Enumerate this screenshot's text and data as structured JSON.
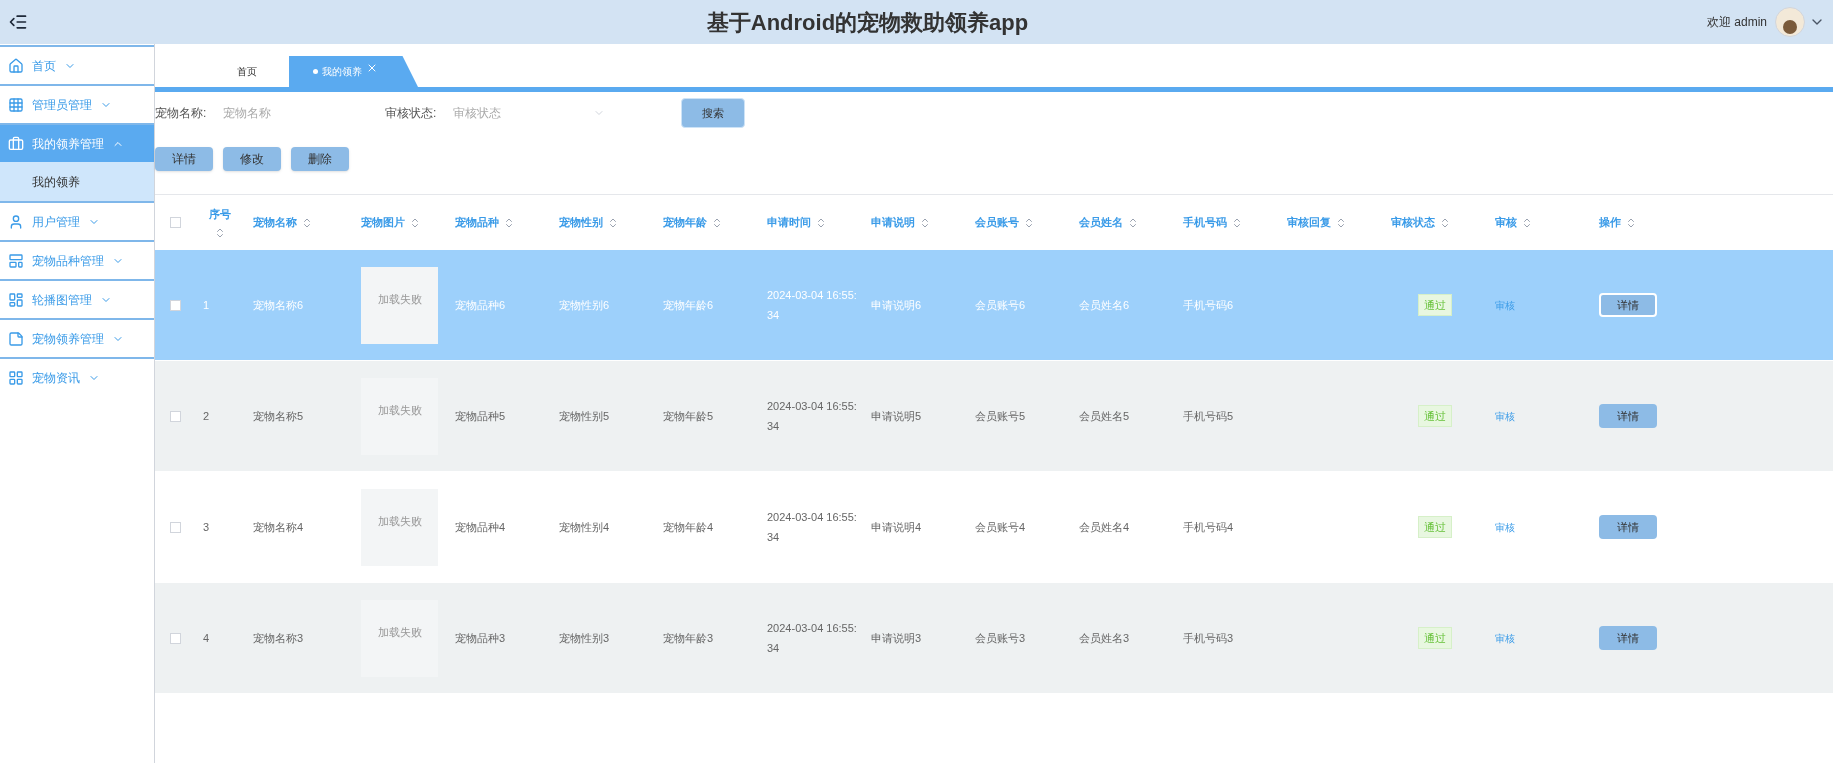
{
  "header": {
    "title": "基于Android的宠物救助领养app",
    "greeting": "欢迎 admin"
  },
  "sidebar": {
    "items": [
      {
        "label": "首页",
        "expanded": false,
        "selected": false
      },
      {
        "label": "管理员管理",
        "expanded": false,
        "selected": false
      },
      {
        "label": "我的领养管理",
        "expanded": true,
        "selected": true,
        "children": [
          {
            "label": "我的领养",
            "selected": true
          }
        ]
      },
      {
        "label": "用户管理",
        "expanded": false,
        "selected": false
      },
      {
        "label": "宠物品种管理",
        "expanded": false,
        "selected": false
      },
      {
        "label": "轮播图管理",
        "expanded": false,
        "selected": false
      },
      {
        "label": "宠物领养管理",
        "expanded": false,
        "selected": false
      },
      {
        "label": "宠物资讯",
        "expanded": false,
        "selected": false
      }
    ]
  },
  "tabs": [
    {
      "label": "首页",
      "selected": false
    },
    {
      "label": "我的领养",
      "selected": true
    }
  ],
  "search": {
    "fields": [
      {
        "label": "宠物名称:",
        "placeholder": "宠物名称",
        "kind": "text"
      },
      {
        "label": "审核状态:",
        "placeholder": "审核状态",
        "kind": "select"
      }
    ],
    "button": "搜索"
  },
  "actions": [
    "详情",
    "修改",
    "删除"
  ],
  "table": {
    "all_checked": false,
    "columns": [
      "序号",
      "宠物名称",
      "宠物图片",
      "宠物品种",
      "宠物性别",
      "宠物年龄",
      "申请时间",
      "申请说明",
      "会员账号",
      "会员姓名",
      "手机号码",
      "审核回复",
      "审核状态",
      "审核",
      "操作"
    ],
    "rows": [
      {
        "selected": true,
        "checked": false,
        "cells": [
          "1",
          "宠物名称6",
          "加载失败",
          "宠物品种6",
          "宠物性别6",
          "宠物年龄6",
          "2024-03-04 16:55:\n34",
          "申请说明6",
          "会员账号6",
          "会员姓名6",
          "手机号码6",
          "",
          "通过",
          "审核",
          "详情"
        ]
      },
      {
        "selected": false,
        "checked": false,
        "cells": [
          "2",
          "宠物名称5",
          "加载失败",
          "宠物品种5",
          "宠物性别5",
          "宠物年龄5",
          "2024-03-04 16:55:\n34",
          "申请说明5",
          "会员账号5",
          "会员姓名5",
          "手机号码5",
          "",
          "通过",
          "审核",
          "详情"
        ]
      },
      {
        "selected": false,
        "checked": false,
        "cells": [
          "3",
          "宠物名称4",
          "加载失败",
          "宠物品种4",
          "宠物性别4",
          "宠物年龄4",
          "2024-03-04 16:55:\n34",
          "申请说明4",
          "会员账号4",
          "会员姓名4",
          "手机号码4",
          "",
          "通过",
          "审核",
          "详情"
        ]
      },
      {
        "selected": false,
        "checked": false,
        "cells": [
          "4",
          "宠物名称3",
          "加载失败",
          "宠物品种3",
          "宠物性别3",
          "宠物年龄3",
          "2024-03-04 16:55:\n34",
          "申请说明3",
          "会员账号3",
          "会员姓名3",
          "手机号码3",
          "",
          "通过",
          "审核",
          "详情"
        ]
      }
    ]
  }
}
